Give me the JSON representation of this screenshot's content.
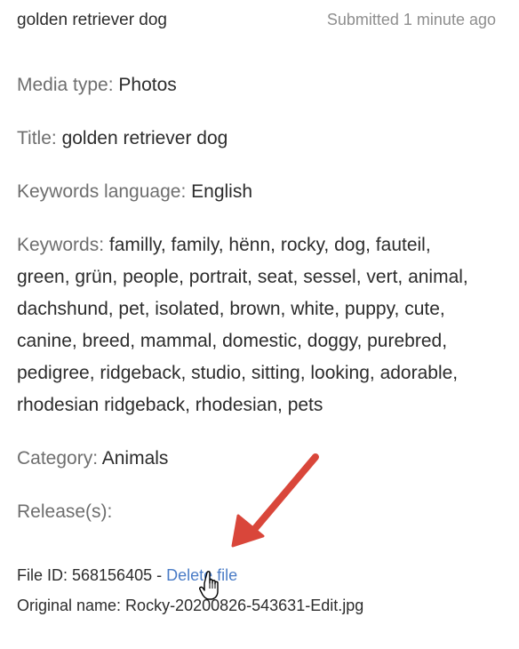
{
  "header": {
    "title": "golden retriever dog",
    "submitted": "Submitted 1 minute ago"
  },
  "fields": {
    "media_type": {
      "label": "Media type: ",
      "value": "Photos"
    },
    "title": {
      "label": "Title: ",
      "value": "golden retriever dog"
    },
    "keywords_language": {
      "label": "Keywords language: ",
      "value": "English"
    },
    "keywords": {
      "label": "Keywords: ",
      "value": "familly, family, hënn, rocky, dog, fauteil, green, grün, people, portrait, seat, sessel, vert, animal, dachshund, pet, isolated, brown, white, puppy, cute, canine, breed, mammal, domestic, doggy, purebred, pedigree, ridgeback, studio, sitting, looking, adorable, rhodesian ridgeback, rhodesian, pets"
    },
    "category": {
      "label": "Category: ",
      "value": "Animals"
    },
    "releases": {
      "label": "Release(s):",
      "value": ""
    }
  },
  "file": {
    "id_label": "File ID: 568156405 - ",
    "delete_label": "Delete file",
    "original_name": "Original name: Rocky-20200826-543631-Edit.jpg"
  },
  "colors": {
    "link": "#4a7cc6",
    "arrow": "#d9463a",
    "label": "#6e6e6e",
    "text": "#2c2c2c"
  },
  "icons": {
    "arrow": "red-annotation-arrow",
    "cursor": "hand-pointer-cursor"
  }
}
